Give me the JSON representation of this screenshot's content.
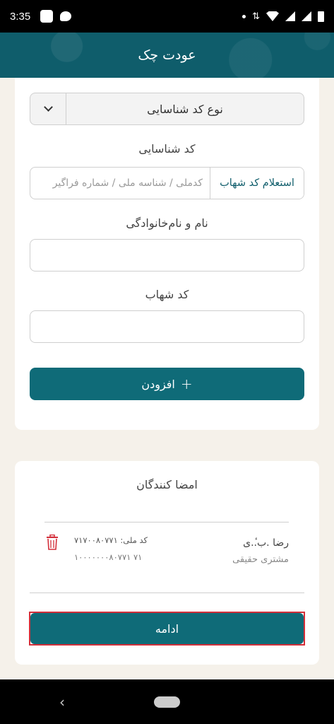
{
  "status_bar": {
    "time": "3:35",
    "icons": [
      "app-square-icon",
      "chat-bubble-icon",
      "dot-icon",
      "data-arrows-icon",
      "wifi-icon",
      "signal-icon",
      "signal-icon",
      "battery-icon"
    ],
    "data_indicator": "⇅"
  },
  "header": {
    "title": "عودت چک"
  },
  "form": {
    "id_type_select": {
      "value": "نوع کد شناسایی"
    },
    "id_code": {
      "label": "کد شناسایی",
      "placeholder": "کدملی / شناسه ملی / شماره فراگیر",
      "inquiry_button": "استعلام کد شهاب"
    },
    "full_name": {
      "label": "نام و نام‌خانوادگی",
      "value": ""
    },
    "shahab_code": {
      "label": "کد شهاب",
      "value": ""
    },
    "add_button": {
      "label": "افزودن",
      "icon": "+"
    }
  },
  "signers": {
    "title": "امضا کنندگان",
    "items": [
      {
        "name": "رضا .ب.ٔ.ی",
        "type": "مشتری حقیقی",
        "national_id": "کد ملی: ۷۱۷‌۰۰۸۰۷۷۱",
        "shahab": "۱۰۰۰۰۰۰۰۸۰۷۷۱ ۷۱"
      }
    ],
    "continue_button": "ادامه"
  },
  "nav_bar": {
    "back": "‹"
  },
  "colors": {
    "primary": "#0f6b78",
    "header": "#0f5d6b",
    "highlight_border": "#d32f3a",
    "delete": "#d32f3a"
  }
}
